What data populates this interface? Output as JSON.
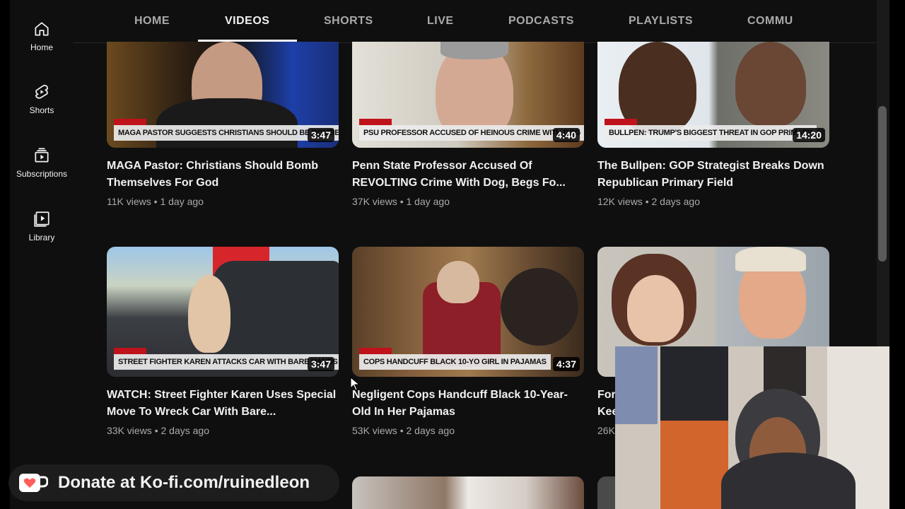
{
  "sidebar": {
    "items": [
      {
        "label": "Home",
        "icon": "home-icon"
      },
      {
        "label": "Shorts",
        "icon": "shorts-icon"
      },
      {
        "label": "Subscriptions",
        "icon": "subscriptions-icon"
      },
      {
        "label": "Library",
        "icon": "library-icon"
      }
    ]
  },
  "tabs": [
    {
      "label": "HOME"
    },
    {
      "label": "VIDEOS",
      "active": true
    },
    {
      "label": "SHORTS"
    },
    {
      "label": "LIVE"
    },
    {
      "label": "PODCASTS"
    },
    {
      "label": "PLAYLISTS"
    },
    {
      "label": "COMMU"
    }
  ],
  "videos": [
    {
      "banner": "MAGA PASTOR SUGGESTS CHRISTIANS SHOULD BE BOMBERS",
      "duration": "3:47",
      "title": "MAGA Pastor: Christians Should Bomb Themselves For God",
      "views": "11K views",
      "age": "1 day ago"
    },
    {
      "banner": "PSU PROFESSOR ACCUSED OF HEINOUS CRIME WITH DOG",
      "duration": "4:40",
      "title": "Penn State Professor Accused Of REVOLTING Crime With Dog, Begs Fo...",
      "views": "37K views",
      "age": "1 day ago"
    },
    {
      "banner": "BULLPEN: TRUMP'S BIGGEST THREAT IN GOP PRIMARY",
      "duration": "14:20",
      "title": "The Bullpen: GOP Strategist Breaks Down Republican Primary Field",
      "views": "12K views",
      "age": "2 days ago"
    },
    {
      "banner": "STREET FIGHTER KAREN ATTACKS CAR WITH BARE HANDS",
      "duration": "3:47",
      "title": "WATCH: Street Fighter Karen Uses Special Move To Wreck Car With Bare...",
      "views": "33K views",
      "age": "2 days ago"
    },
    {
      "banner": "COPS HANDCUFF BLACK 10-YO GIRL IN PAJAMAS",
      "duration": "4:37",
      "title": "Negligent Cops Handcuff Black 10-Year-Old In Her Pajamas",
      "views": "53K views",
      "age": "2 days ago"
    },
    {
      "title": "For",
      "title2": "Kee",
      "views": "26K"
    }
  ],
  "meta_separator": "•",
  "kofi": {
    "text": "Donate at Ko-fi.com/ruinedleon"
  },
  "colors": {
    "background": "#0f0f0f",
    "text": "#f1f1f1",
    "secondary_text": "#aaaaaa",
    "banner_red": "#c0121b",
    "kofi_heart": "#ff5e5b"
  }
}
